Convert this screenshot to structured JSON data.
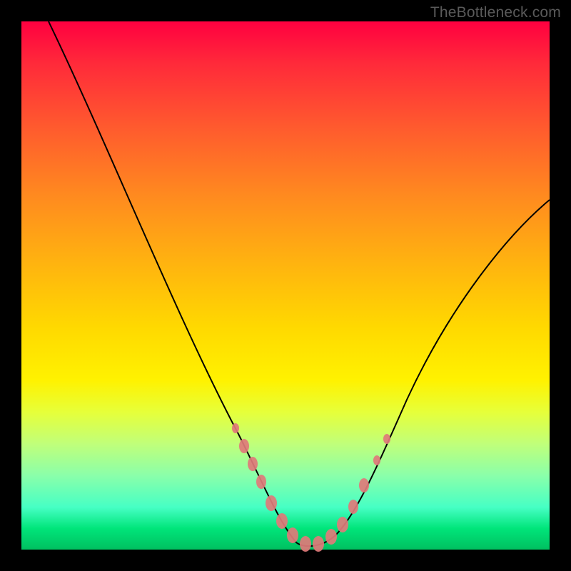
{
  "watermark": "TheBottleneck.com",
  "chart_data": {
    "type": "line",
    "title": "",
    "xlabel": "",
    "ylabel": "",
    "xlim": [
      0,
      100
    ],
    "ylim": [
      0,
      100
    ],
    "series": [
      {
        "name": "curve",
        "x": [
          0,
          5,
          10,
          15,
          20,
          25,
          30,
          35,
          40,
          43,
          45,
          48,
          50,
          52,
          55,
          58,
          60,
          65,
          70,
          75,
          80,
          85,
          90,
          95,
          100
        ],
        "y": [
          100,
          92,
          83,
          73,
          63,
          52,
          41,
          30,
          18,
          11,
          7,
          3,
          1,
          0,
          0,
          1,
          3,
          9,
          17,
          26,
          34,
          42,
          50,
          57,
          63
        ]
      }
    ],
    "markers": {
      "name": "highlighted-points",
      "color": "#e07a7a",
      "points": [
        {
          "x": 39,
          "y": 23
        },
        {
          "x": 41,
          "y": 17
        },
        {
          "x": 43,
          "y": 12
        },
        {
          "x": 45,
          "y": 8
        },
        {
          "x": 47,
          "y": 4
        },
        {
          "x": 49,
          "y": 1
        },
        {
          "x": 51,
          "y": 0
        },
        {
          "x": 53,
          "y": 0
        },
        {
          "x": 55,
          "y": 0
        },
        {
          "x": 57,
          "y": 2
        },
        {
          "x": 59,
          "y": 5
        },
        {
          "x": 61,
          "y": 9
        },
        {
          "x": 63,
          "y": 13
        },
        {
          "x": 65,
          "y": 18
        },
        {
          "x": 67,
          "y": 23
        }
      ]
    },
    "background_gradient": {
      "top": "#ff0040",
      "mid": "#fff200",
      "bottom": "#00c060"
    }
  }
}
